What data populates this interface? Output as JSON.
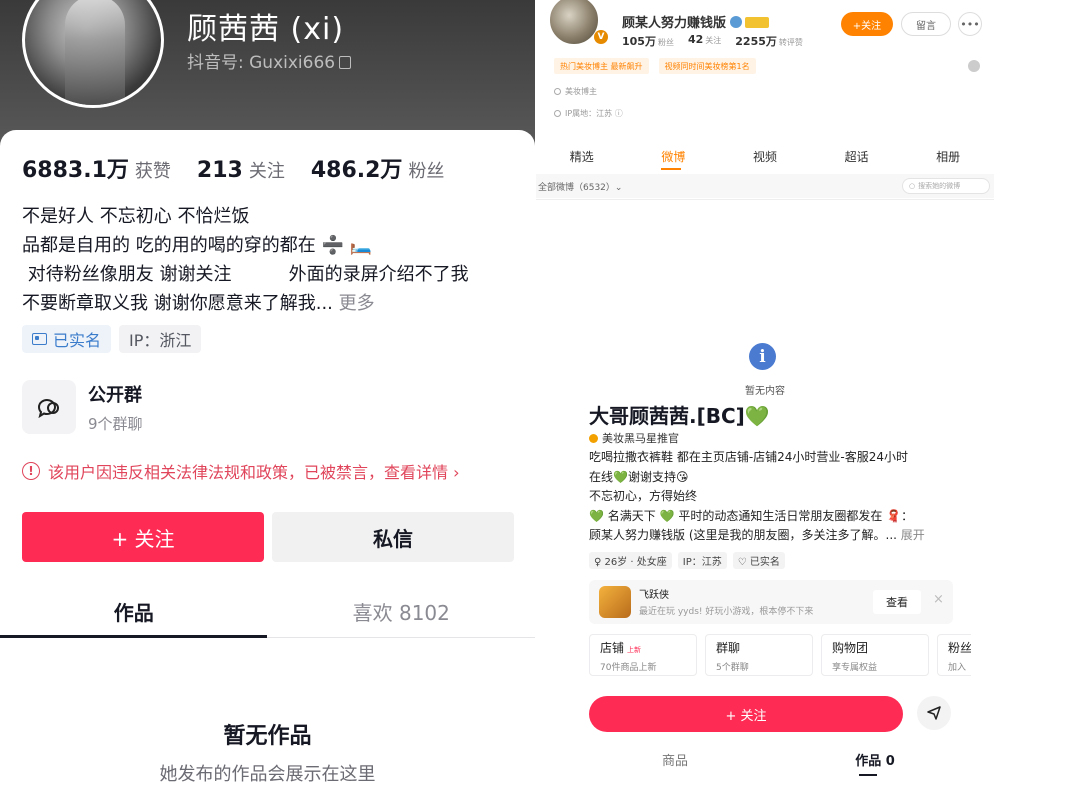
{
  "left": {
    "name": "顾茜茜 (xi)",
    "douyin_id": "抖音号: Guxixi666",
    "stats": [
      {
        "num": "6883.1万",
        "label": "获赞"
      },
      {
        "num": "213",
        "label": "关注"
      },
      {
        "num": "486.2万",
        "label": "粉丝"
      }
    ],
    "bio_lines": [
      "不是好人 不忘初心 不恰烂饭",
      "品都是自用的 吃的用的喝的穿的都在 ➗ 🛏️",
      " 对待粉丝像朋友 谢谢关注          外面的录屏介绍不了我",
      "不要断章取义我 谢谢你愿意来了解我..."
    ],
    "bio_more": "更多",
    "tag_verified": "已实名",
    "tag_ip": "IP：浙江",
    "group_title": "公开群",
    "group_sub": "9个群聊",
    "notice": "该用户因违反相关法律法规和政策，已被禁言，查看详情 ›",
    "follow_label": "+ 关注",
    "message_label": "私信",
    "tabs": [
      "作品",
      "喜欢 8102"
    ],
    "empty_title": "暂无作品",
    "empty_sub": "她发布的作品会展示在这里"
  },
  "weibo": {
    "name": "顾某人努力赚钱版",
    "stats": [
      {
        "num": "105万",
        "label": "粉丝"
      },
      {
        "num": "42",
        "label": "关注"
      },
      {
        "num": "2255万",
        "label": "转评赞"
      }
    ],
    "follow_label": "+关注",
    "leave_label": "留言",
    "more_label": "•••",
    "badges": [
      "热门美妆博主 最新飙升",
      "视频同时间美妆榜第1名"
    ],
    "meta_role": "美妆博主",
    "meta_ip": "IP属地：江苏 ⓘ",
    "tabs": [
      "精选",
      "微博",
      "视频",
      "超话",
      "相册"
    ],
    "filter_all": "全部微博（6532）⌄",
    "search_placeholder": "搜索她的微博",
    "empty_text": "暂无内容"
  },
  "right": {
    "title": "大哥顾茜茜.[BC]💚",
    "cert": "美妆黑马星推官",
    "bio_lines": [
      "吃喝拉撒衣裤鞋 都在主页店铺-店铺24小时营业-客服24小时",
      "在线💚谢谢支持😘",
      "不忘初心，方得始终",
      "💚 名满天下 💚 平时的动态通知生活日常朋友圈都发在 🧣：",
      "顾某人努力赚钱版 (这里是我的朋友圈，多关注多了解。..."
    ],
    "bio_more": "展开",
    "chips": [
      "♀ 26岁 · 处女座",
      "IP：江苏",
      "♡ 已实名"
    ],
    "game": {
      "name": "飞跃侠",
      "desc": "最近在玩 yyds! 好玩小游戏，根本停不下来",
      "button": "查看",
      "close": "×"
    },
    "cards": [
      {
        "title": "店铺",
        "new": "上新",
        "sub": "70件商品上新"
      },
      {
        "title": "群聊",
        "new": "",
        "sub": "5个群聊"
      },
      {
        "title": "购物团",
        "new": "",
        "sub": "享专属权益"
      },
      {
        "title": "粉丝",
        "new": "",
        "sub": "加入"
      }
    ],
    "follow_label": "+ 关注",
    "tabs": [
      "商品",
      "作品 0"
    ]
  },
  "colors": {
    "douyin_red": "#fe2c55",
    "weibo_orange": "#ff8200",
    "notice_red": "#e0455b"
  }
}
